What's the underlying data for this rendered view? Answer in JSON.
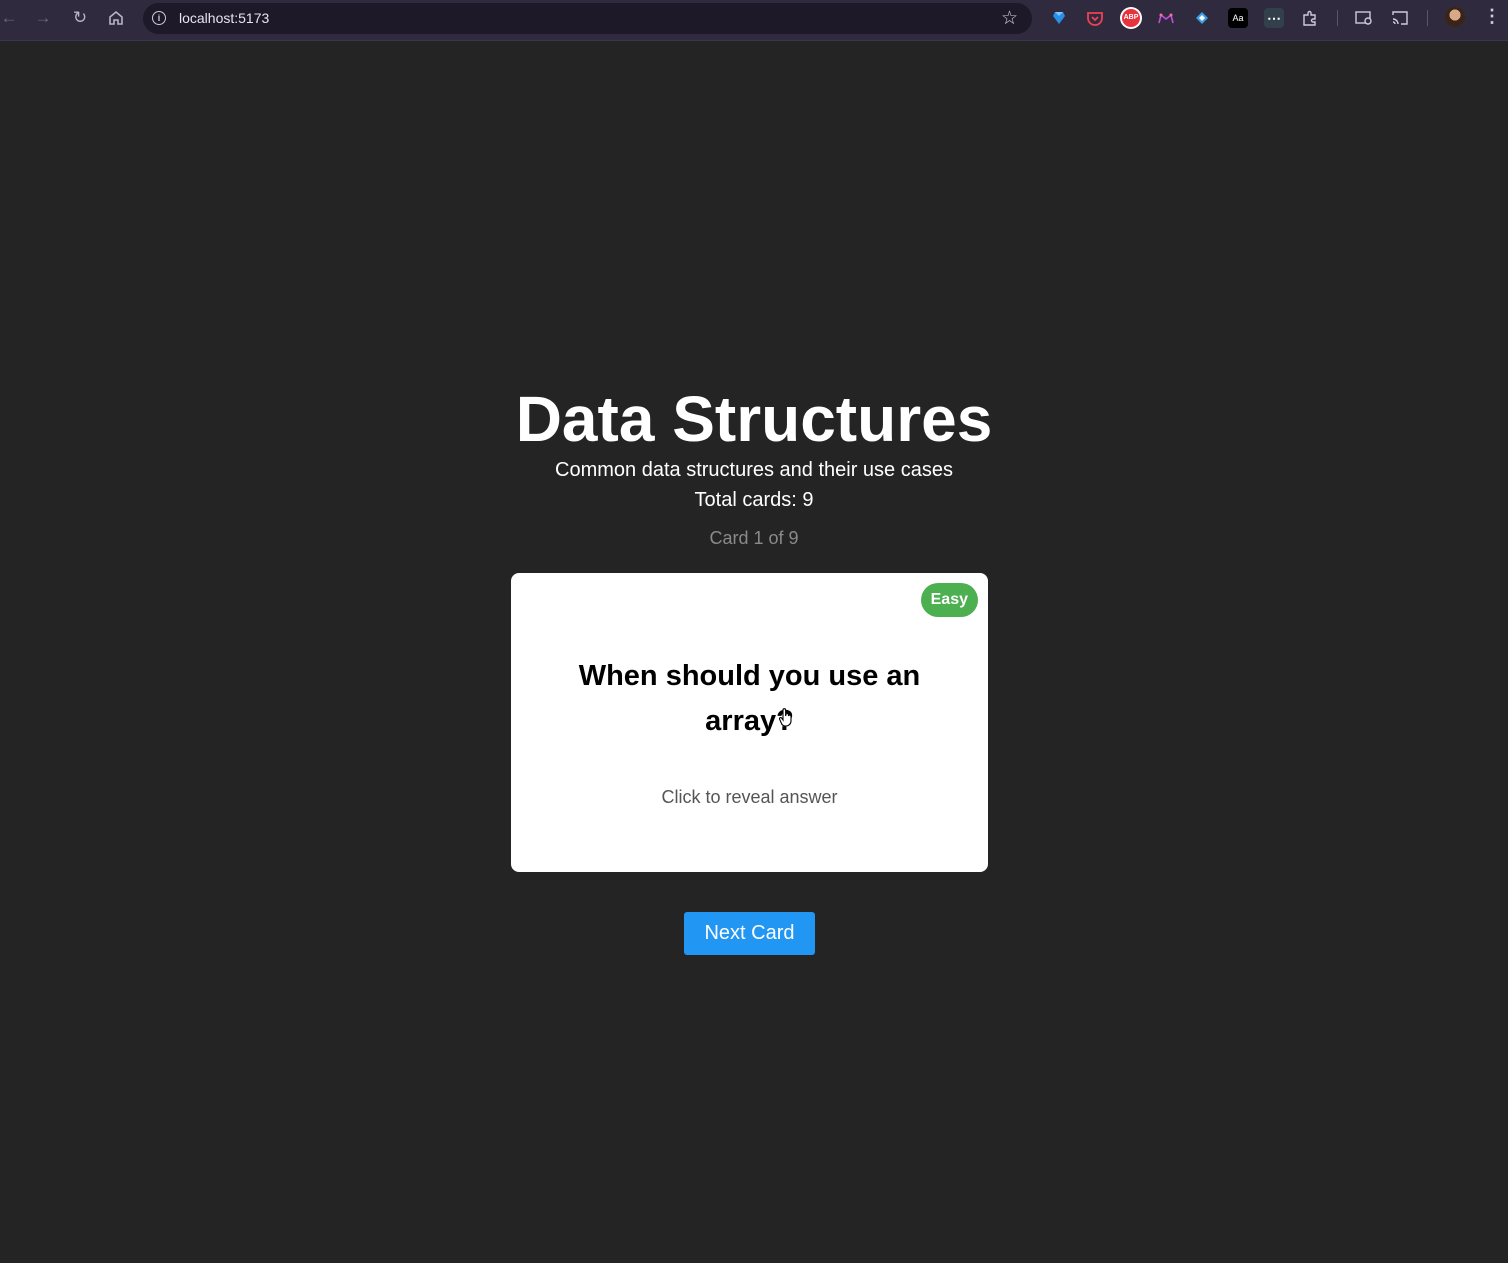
{
  "browser": {
    "url": "localhost:5173",
    "back_icon": "arrow-left-icon",
    "forward_icon": "arrow-right-icon",
    "reload_icon": "reload-icon",
    "home_icon": "home-icon",
    "extensions": [
      "gem-icon",
      "pocket-icon",
      "adblock-icon",
      "crown-icon",
      "dropbox-icon",
      "dictionary-icon",
      "dots-icon",
      "puzzle-icon"
    ],
    "adblock_label": "ABP",
    "dictionary_label": "Aa"
  },
  "page": {
    "title": "Data Structures",
    "subtitle": "Common data structures and their use cases",
    "total_cards": "Total cards: 9",
    "counter": "Card 1 of 9"
  },
  "card": {
    "difficulty": "Easy",
    "difficulty_color": "#4caf50",
    "question": "When should you use an array?",
    "hint": "Click to reveal answer"
  },
  "actions": {
    "next_label": "Next Card",
    "accent": "#2196f3"
  }
}
